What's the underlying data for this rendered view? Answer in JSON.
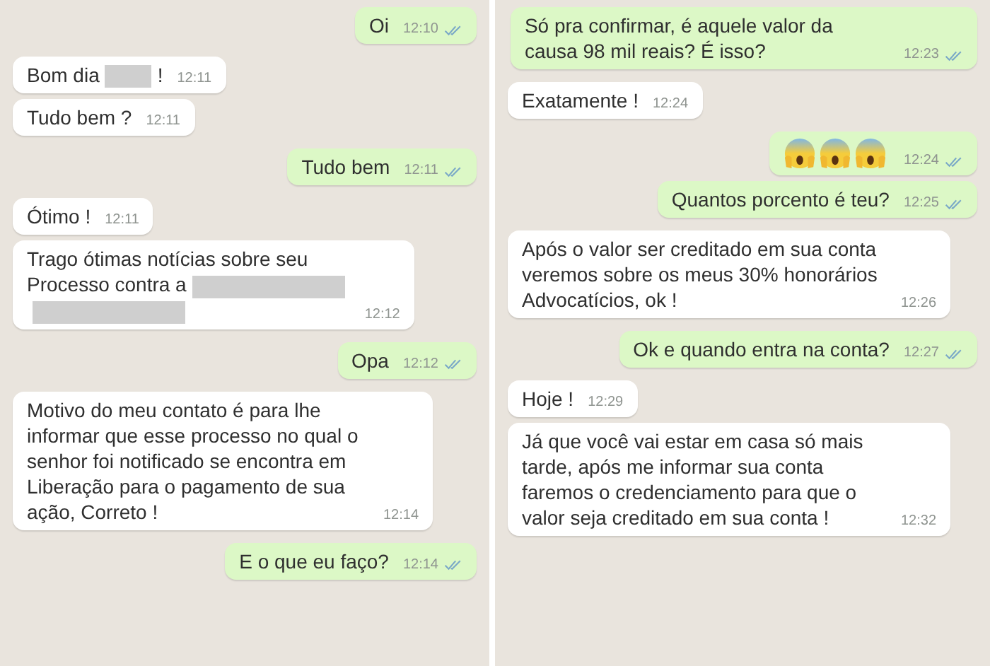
{
  "panels": [
    {
      "messages": [
        {
          "outgoing": true,
          "parts": [
            {
              "kind": "text",
              "text": "Oi"
            }
          ],
          "time": "12:10",
          "read": true
        },
        {
          "outgoing": false,
          "parts": [
            {
              "kind": "text",
              "text": "Bom dia"
            },
            {
              "kind": "redacted",
              "wide": false
            },
            {
              "kind": "text",
              "text": "!"
            }
          ],
          "time": "12:11"
        },
        {
          "outgoing": false,
          "parts": [
            {
              "kind": "text",
              "text": "Tudo bem ?"
            }
          ],
          "time": "12:11"
        },
        {
          "outgoing": true,
          "parts": [
            {
              "kind": "text",
              "text": "Tudo bem"
            }
          ],
          "time": "12:11",
          "read": true
        },
        {
          "outgoing": false,
          "parts": [
            {
              "kind": "text",
              "text": "Ótimo !"
            }
          ],
          "time": "12:11"
        },
        {
          "outgoing": false,
          "parts": [
            {
              "kind": "text",
              "text": "Trago ótimas notícias sobre seu"
            },
            {
              "kind": "break"
            },
            {
              "kind": "text",
              "text": "Processo contra a"
            },
            {
              "kind": "redacted",
              "wide": true
            },
            {
              "kind": "break"
            },
            {
              "kind": "redacted",
              "wide": true
            }
          ],
          "time": "12:12"
        },
        {
          "outgoing": true,
          "parts": [
            {
              "kind": "text",
              "text": "Opa"
            }
          ],
          "time": "12:12",
          "read": true
        },
        {
          "outgoing": false,
          "parts": [
            {
              "kind": "text",
              "text": "Motivo do meu contato é para lhe informar que esse processo no qual o senhor foi notificado se encontra em Liberação para o pagamento de sua ação, Correto !"
            }
          ],
          "time": "12:14"
        },
        {
          "outgoing": true,
          "parts": [
            {
              "kind": "text",
              "text": "E o que eu faço?"
            }
          ],
          "time": "12:14",
          "read": true
        }
      ]
    },
    {
      "messages": [
        {
          "outgoing": true,
          "parts": [
            {
              "kind": "text",
              "text": "Só pra confirmar, é aquele valor da causa 98 mil reais? É isso?"
            }
          ],
          "time": "12:23",
          "read": true
        },
        {
          "outgoing": false,
          "parts": [
            {
              "kind": "text",
              "text": "Exatamente !"
            }
          ],
          "time": "12:24"
        },
        {
          "outgoing": true,
          "parts": [
            {
              "kind": "emoji"
            },
            {
              "kind": "emoji"
            },
            {
              "kind": "emoji"
            }
          ],
          "time": "12:24",
          "read": true
        },
        {
          "outgoing": true,
          "parts": [
            {
              "kind": "text",
              "text": "Quantos porcento é teu?"
            }
          ],
          "time": "12:25",
          "read": true
        },
        {
          "outgoing": false,
          "parts": [
            {
              "kind": "text",
              "text": "Após o valor ser creditado em sua conta veremos sobre os meus 30% honorários Advocatícios, ok !"
            }
          ],
          "time": "12:26"
        },
        {
          "outgoing": true,
          "parts": [
            {
              "kind": "text",
              "text": "Ok e quando entra na conta?"
            }
          ],
          "time": "12:27",
          "read": true
        },
        {
          "outgoing": false,
          "parts": [
            {
              "kind": "text",
              "text": "Hoje !"
            }
          ],
          "time": "12:29"
        },
        {
          "outgoing": false,
          "parts": [
            {
              "kind": "text",
              "text": "Já que você vai estar em casa só mais tarde, após me informar sua conta faremos o credenciamento para que o valor seja creditado em sua conta !"
            }
          ],
          "time": "12:32"
        }
      ]
    }
  ]
}
